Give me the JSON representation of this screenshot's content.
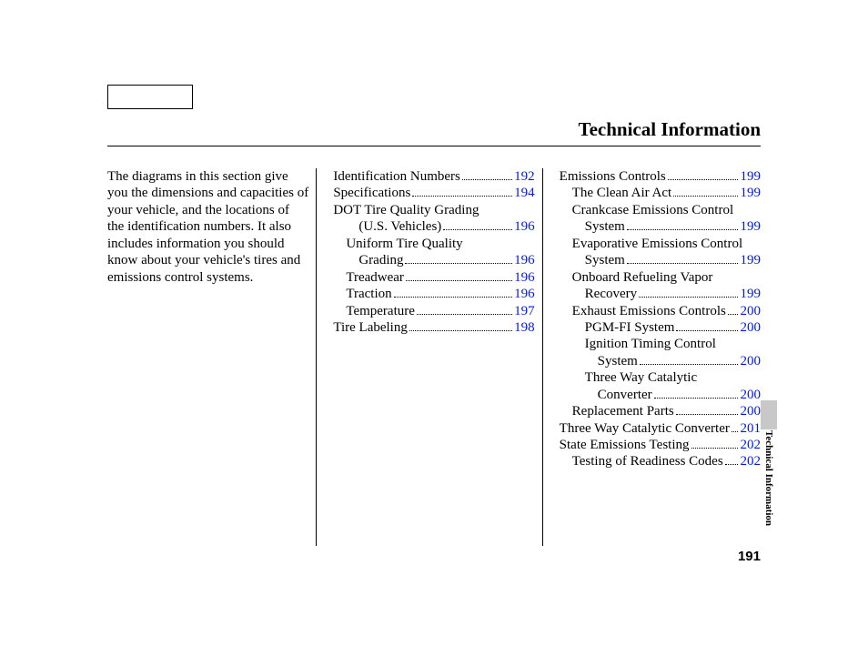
{
  "pageTitle": "Technical Information",
  "intro": "The diagrams in this section give you the dimensions and capacities of your vehicle, and the locations of the identification numbers. It also includes information you should know about your vehicle's tires and emissions control systems.",
  "col2": [
    {
      "label": "Identification Numbers",
      "page": "192",
      "indent": 0
    },
    {
      "label": "Specifications",
      "page": "194",
      "indent": 0
    },
    {
      "label": "DOT Tire Quality Grading",
      "indent": 0
    },
    {
      "label": "(U.S. Vehicles)",
      "page": "196",
      "indent": 2
    },
    {
      "label": "Uniform Tire Quality",
      "indent": 1
    },
    {
      "label": "Grading",
      "page": "196",
      "indent": 2
    },
    {
      "label": "Treadwear",
      "page": "196",
      "indent": 1
    },
    {
      "label": "Traction",
      "page": "196",
      "indent": 1
    },
    {
      "label": "Temperature",
      "page": "197",
      "indent": 1
    },
    {
      "label": "Tire Labeling",
      "page": "198",
      "indent": 0
    }
  ],
  "col3": [
    {
      "label": "Emissions Controls",
      "page": "199",
      "indent": 0
    },
    {
      "label": "The Clean Air Act",
      "page": "199",
      "indent": 1
    },
    {
      "label": "Crankcase Emissions Control",
      "indent": 1
    },
    {
      "label": "System",
      "page": "199",
      "indent": 2
    },
    {
      "label": "Evaporative Emissions Control",
      "indent": 1
    },
    {
      "label": "System",
      "page": "199",
      "indent": 2
    },
    {
      "label": "Onboard Refueling Vapor",
      "indent": 1
    },
    {
      "label": "Recovery",
      "page": "199",
      "indent": 2
    },
    {
      "label": "Exhaust Emissions Controls",
      "page": "200",
      "indent": 1
    },
    {
      "label": "PGM-FI System",
      "page": "200",
      "indent": 2
    },
    {
      "label": "Ignition Timing Control",
      "indent": 2
    },
    {
      "label": "System",
      "page": "200",
      "indent": 3
    },
    {
      "label": "Three Way Catalytic",
      "indent": 2
    },
    {
      "label": "Converter",
      "page": "200",
      "indent": 3
    },
    {
      "label": "Replacement Parts",
      "page": "200",
      "indent": 1
    },
    {
      "label": "Three Way Catalytic Converter",
      "page": "201",
      "indent": 0
    },
    {
      "label": "State Emissions Testing",
      "page": "202",
      "indent": 0
    },
    {
      "label": "Testing of Readiness Codes",
      "page": "202",
      "indent": 1
    }
  ],
  "pageNum": "191",
  "sideLabel": "Technical Information"
}
